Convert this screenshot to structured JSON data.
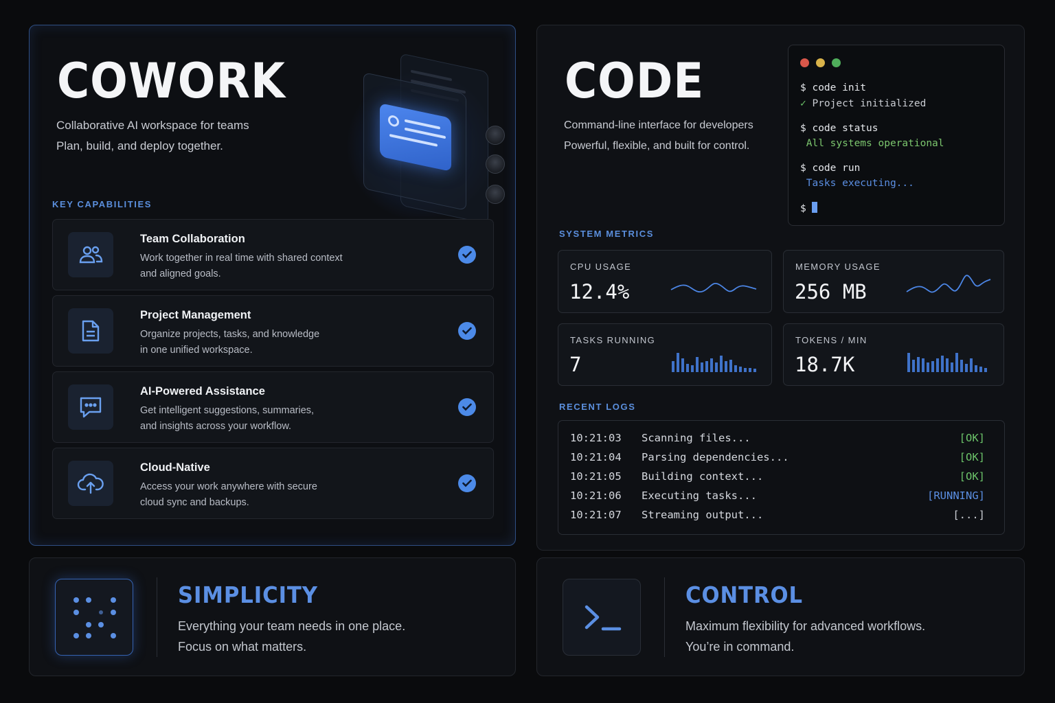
{
  "cowork": {
    "title": "COWORK",
    "subtitle_line1": "Collaborative AI workspace for teams",
    "subtitle_line2": "Plan, build, and deploy together.",
    "section_label": "KEY CAPABILITIES",
    "capabilities": [
      {
        "title": "Team Collaboration",
        "desc_line1": "Work together in real time with shared context",
        "desc_line2": "and aligned goals.",
        "icon": "users-icon",
        "checked": true
      },
      {
        "title": "Project Management",
        "desc_line1": "Organize projects, tasks, and knowledge",
        "desc_line2": "in one unified workspace.",
        "icon": "document-icon",
        "checked": true
      },
      {
        "title": "AI-Powered Assistance",
        "desc_line1": "Get intelligent suggestions, summaries,",
        "desc_line2": "and insights across your workflow.",
        "icon": "chat-bubble-icon",
        "checked": true
      },
      {
        "title": "Cloud-Native",
        "desc_line1": "Access your work anywhere with secure",
        "desc_line2": "cloud sync and backups.",
        "icon": "cloud-upload-icon",
        "checked": true
      }
    ]
  },
  "code": {
    "title": "CODE",
    "subtitle_line1": "Command-line interface for developers",
    "subtitle_line2": "Powerful, flexible, and built for control.",
    "terminal": {
      "lines": [
        {
          "text": "$ code init",
          "kind": "cmd"
        },
        {
          "text": "✓ Project initialized",
          "kind": "output"
        },
        {
          "text": "$ code status",
          "kind": "cmd"
        },
        {
          "text": " All systems operational",
          "kind": "success"
        },
        {
          "text": "$ code run",
          "kind": "cmd"
        },
        {
          "text": " Tasks executing...",
          "kind": "info"
        },
        {
          "text": "$ ",
          "kind": "prompt"
        }
      ]
    },
    "metrics_label": "SYSTEM METRICS",
    "metrics": {
      "cpu": {
        "label": "CPU USAGE",
        "value": "12.4%"
      },
      "memory": {
        "label": "MEMORY USAGE",
        "value": "256 MB"
      },
      "tasks": {
        "label": "TASKS RUNNING",
        "value": "7"
      },
      "tokens": {
        "label": "TOKENS / MIN",
        "value": "18.7K"
      }
    },
    "logs_label": "RECENT LOGS",
    "logs": [
      {
        "time": "10:21:03",
        "msg": "Scanning files...",
        "status": "[OK]",
        "kind": "ok"
      },
      {
        "time": "10:21:04",
        "msg": "Parsing dependencies...",
        "status": "[OK]",
        "kind": "ok"
      },
      {
        "time": "10:21:05",
        "msg": "Building context...",
        "status": "[OK]",
        "kind": "ok"
      },
      {
        "time": "10:21:06",
        "msg": "Executing tasks...",
        "status": "[RUNNING]",
        "kind": "running"
      },
      {
        "time": "10:21:07",
        "msg": "Streaming output...",
        "status": "[...]",
        "kind": "pending"
      }
    ]
  },
  "simplicity": {
    "title": "SIMPLICITY",
    "line1": "Everything your team needs in one place.",
    "line2": "Focus on what matters.",
    "icon": "dot-grid-icon"
  },
  "control": {
    "title": "CONTROL",
    "line1": "Maximum flexibility for advanced workflows.",
    "line2": "You’re in command.",
    "icon": "terminal-prompt-icon"
  },
  "colors": {
    "accent": "#4c8ae8",
    "success": "#7cc66e",
    "info": "#5b8fe3",
    "window_red": "#d9574a",
    "window_yellow": "#d9b34a",
    "window_green": "#4fae5b"
  }
}
